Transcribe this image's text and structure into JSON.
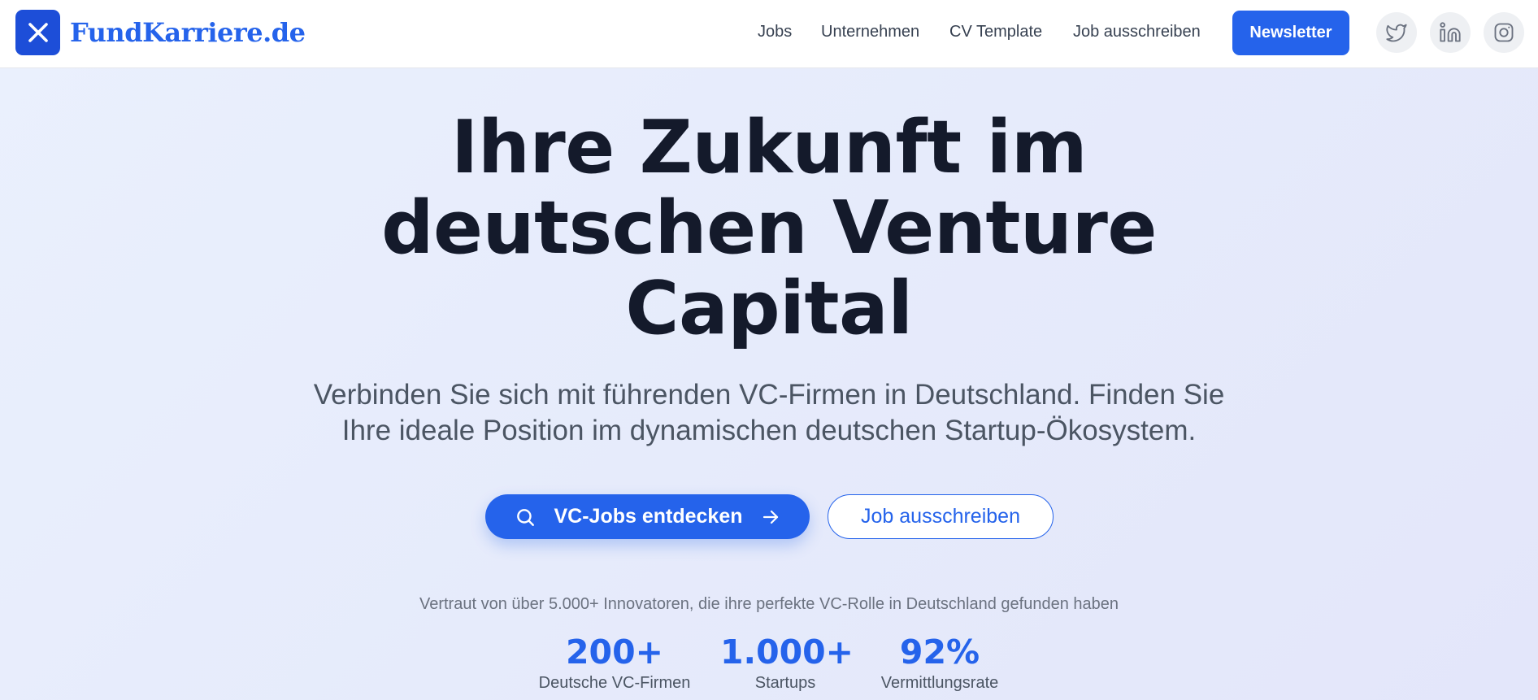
{
  "brand": {
    "name": "FundKarriere.de",
    "logo_icon": "x-mark-icon",
    "accent_color": "#2563eb"
  },
  "nav": {
    "links": [
      {
        "label": "Jobs"
      },
      {
        "label": "Unternehmen"
      },
      {
        "label": "CV Template"
      },
      {
        "label": "Job ausschreiben"
      }
    ],
    "newsletter_label": "Newsletter",
    "social": [
      {
        "icon": "twitter-icon"
      },
      {
        "icon": "linkedin-icon"
      },
      {
        "icon": "instagram-icon"
      }
    ]
  },
  "hero": {
    "title_lines": [
      "Ihre Zukunft im",
      "deutschen Venture",
      "Capital"
    ],
    "subtitle_lines": [
      "Verbinden Sie sich mit führenden VC-Firmen in Deutschland. Finden Sie",
      "Ihre ideale Position im dynamischen deutschen Startup-Ökosystem."
    ],
    "primary_cta": "VC-Jobs entdecken",
    "secondary_cta": "Job ausschreiben",
    "trust_text": "Vertraut von über 5.000+ Innovatoren, die ihre perfekte VC-Rolle in Deutschland gefunden haben"
  },
  "stats": [
    {
      "value": "200+",
      "label": "Deutsche VC-Firmen"
    },
    {
      "value": "1.000+",
      "label": "Startups"
    },
    {
      "value": "92%",
      "label": "Vermittlungsrate"
    }
  ]
}
